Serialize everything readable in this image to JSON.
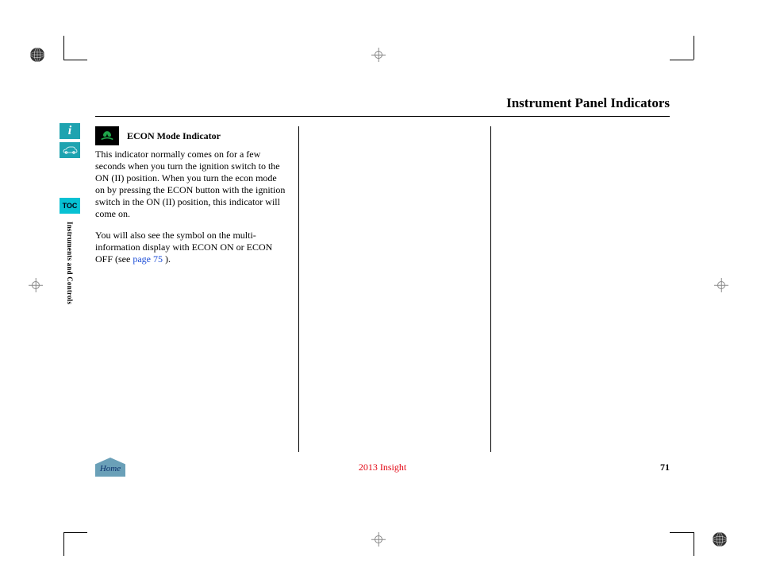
{
  "page_title": "Instrument Panel Indicators",
  "section": {
    "heading": "ECON Mode Indicator",
    "icon_name": "econ-leaf-icon",
    "para1": "This indicator normally comes on for a few seconds when you turn the ignition switch to the ON (II) position. When you turn the econ mode on by pressing the ECON button with the ignition switch in the ON (II) position, this indicator will come on.",
    "para2_pre": "You will also see the symbol on the multi-information display with ECON ON or ECON OFF (see ",
    "para2_link": "page 75",
    "para2_post": " )."
  },
  "sidebar": {
    "info_label": "i",
    "toc_label": "TOC",
    "section_label": "Instruments and Controls"
  },
  "footer": {
    "home_label": "Home",
    "center": "2013 Insight",
    "page_number": "71"
  }
}
